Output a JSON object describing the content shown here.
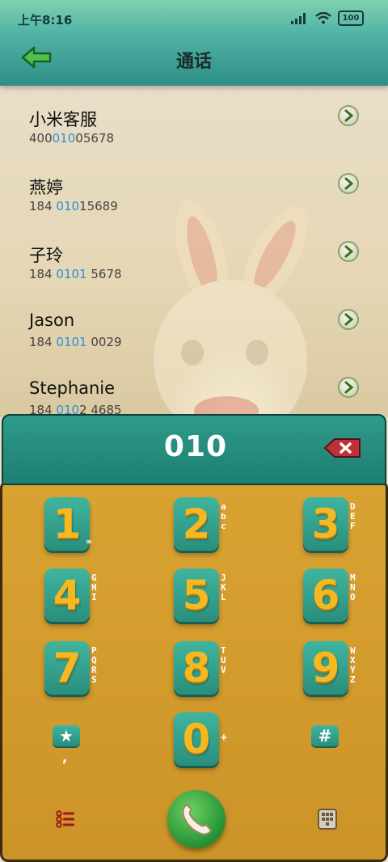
{
  "status_bar": {
    "time": "上午8:16",
    "battery": "100"
  },
  "header": {
    "title": "通话"
  },
  "contacts": [
    {
      "name": "小米客服",
      "number_pre": "400",
      "number_hl": "010",
      "number_post": "05678"
    },
    {
      "name": "燕婷",
      "number_pre": "184 ",
      "number_hl": "010",
      "number_post": "15689"
    },
    {
      "name": "子玲",
      "number_pre": "184 ",
      "number_hl": "0101",
      "number_post": " 5678"
    },
    {
      "name": "Jason",
      "number_pre": "184 ",
      "number_hl": "0101",
      "number_post": " 0029"
    },
    {
      "name": "Stephanie",
      "number_pre": "184 ",
      "number_hl": "010",
      "number_post": "2 4685"
    }
  ],
  "dialer": {
    "number": "010"
  },
  "keys": [
    {
      "digit": "1",
      "letters": "∞"
    },
    {
      "digit": "2",
      "letters": "abc"
    },
    {
      "digit": "3",
      "letters": "DEF"
    },
    {
      "digit": "4",
      "letters": "GHI"
    },
    {
      "digit": "5",
      "letters": "JKL"
    },
    {
      "digit": "6",
      "letters": "MNO"
    },
    {
      "digit": "7",
      "letters": "PQRS"
    },
    {
      "digit": "8",
      "letters": "TUV"
    },
    {
      "digit": "9",
      "letters": "WXYZ"
    },
    {
      "digit": "0",
      "letters": "+"
    }
  ],
  "special_keys": {
    "star": "★",
    "star_sub": ",",
    "hash": "#"
  },
  "icons": {
    "back": "back-arrow-icon",
    "detail": "chevron-right-icon",
    "backspace": "backspace-icon",
    "call": "phone-icon",
    "menu": "list-menu-icon",
    "keypad": "keypad-icon"
  },
  "colors": {
    "accent": "#2f9a8a",
    "highlight": "#2a8fd6",
    "keypad_bg": "#d9a332",
    "digit": "#f6b820"
  }
}
